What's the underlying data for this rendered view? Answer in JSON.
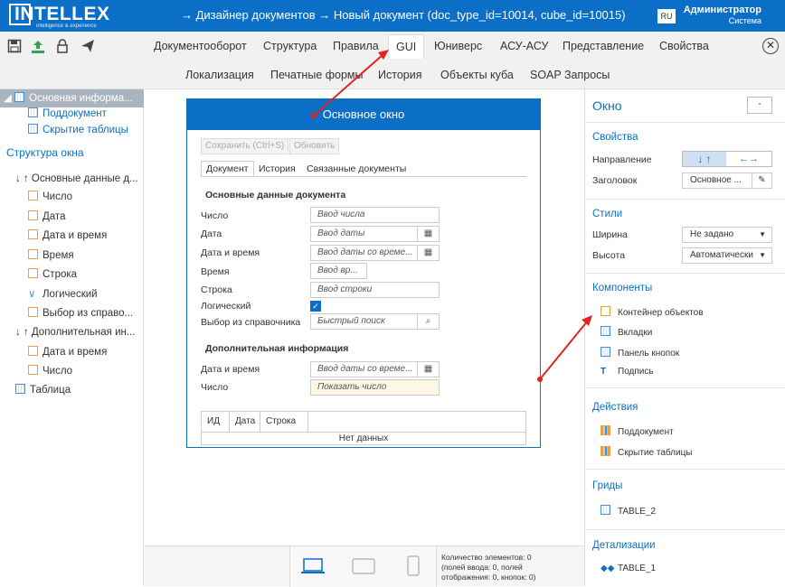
{
  "app": {
    "logo": "INTELLEX",
    "logo_sub": "intelligence & experience",
    "title": "→ Дизайнер документов → Новый документ (doc_type_id=10014, cube_id=10015)",
    "lang": "RU",
    "user_name": "Администратор",
    "user_role": "Система"
  },
  "tabs_row1": [
    "Документооборот",
    "Структура",
    "Правила",
    "GUI",
    "Юниверс",
    "АСУ-АСУ",
    "Представление",
    "Свойства"
  ],
  "tabs_row2": [
    "Локализация",
    "Печатные формы",
    "История",
    "Объекты куба",
    "SOAP Запросы"
  ],
  "left": {
    "root": "Основная информа...",
    "children": [
      "Поддокумент",
      "Скрытие таблицы"
    ],
    "structure_title": "Структура окна",
    "group1": "↓ ↑ Основные данные д...",
    "group1_items": [
      "Число",
      "Дата",
      "Дата и время",
      "Время",
      "Строка",
      "Логический",
      "Выбор из справо..."
    ],
    "group2": "↓ ↑ Дополнительная ин...",
    "group2_items": [
      "Дата и время",
      "Число"
    ],
    "table": "Таблица"
  },
  "window": {
    "title": "Основное окно",
    "save_btn": "Сохранить (Ctrl+S)",
    "refresh_btn": "Обновить",
    "tabs": [
      "Документ",
      "История",
      "Связанные документы"
    ],
    "section1": "Основные данные документа",
    "fields": [
      {
        "label": "Число",
        "placeholder": "Ввод числа"
      },
      {
        "label": "Дата",
        "placeholder": "Ввод даты"
      },
      {
        "label": "Дата и время",
        "placeholder": "Ввод даты со време..."
      },
      {
        "label": "Время",
        "placeholder": "Ввод вр..."
      },
      {
        "label": "Строка",
        "placeholder": "Ввод строки"
      },
      {
        "label": "Логический",
        "placeholder": ""
      },
      {
        "label": "Выбор из справочника",
        "placeholder": "Быстрый поиск"
      }
    ],
    "section2": "Дополнительная информация",
    "fields2": [
      {
        "label": "Дата и время",
        "placeholder": "Ввод даты со време..."
      },
      {
        "label": "Число",
        "placeholder": "Показать число"
      }
    ],
    "grid_cols": [
      "ИД",
      "Дата",
      "Строка"
    ],
    "grid_empty": "Нет данных"
  },
  "bottom": {
    "count": "Количество элементов: 0",
    "line2": "(полей ввода: 0, полей",
    "line3": "отображения: 0, кнопок: 0)"
  },
  "right": {
    "title": "Окно",
    "props_title": "Свойства",
    "direction_label": "Направление",
    "caption_label": "Заголовок",
    "caption_value": "Основное ...",
    "styles_title": "Стили",
    "width_label": "Ширина",
    "width_value": "Не задано",
    "height_label": "Высота",
    "height_value": "Автоматически",
    "components_title": "Компоненты",
    "components": [
      "Контейнер объектов",
      "Вкладки",
      "Панель кнопок",
      "Подпись"
    ],
    "actions_title": "Действия",
    "actions": [
      "Поддокумент",
      "Скрытие таблицы"
    ],
    "grids_title": "Гриды",
    "grids": [
      "TABLE_2"
    ],
    "details_title": "Детализации",
    "details": [
      "TABLE_1"
    ]
  }
}
